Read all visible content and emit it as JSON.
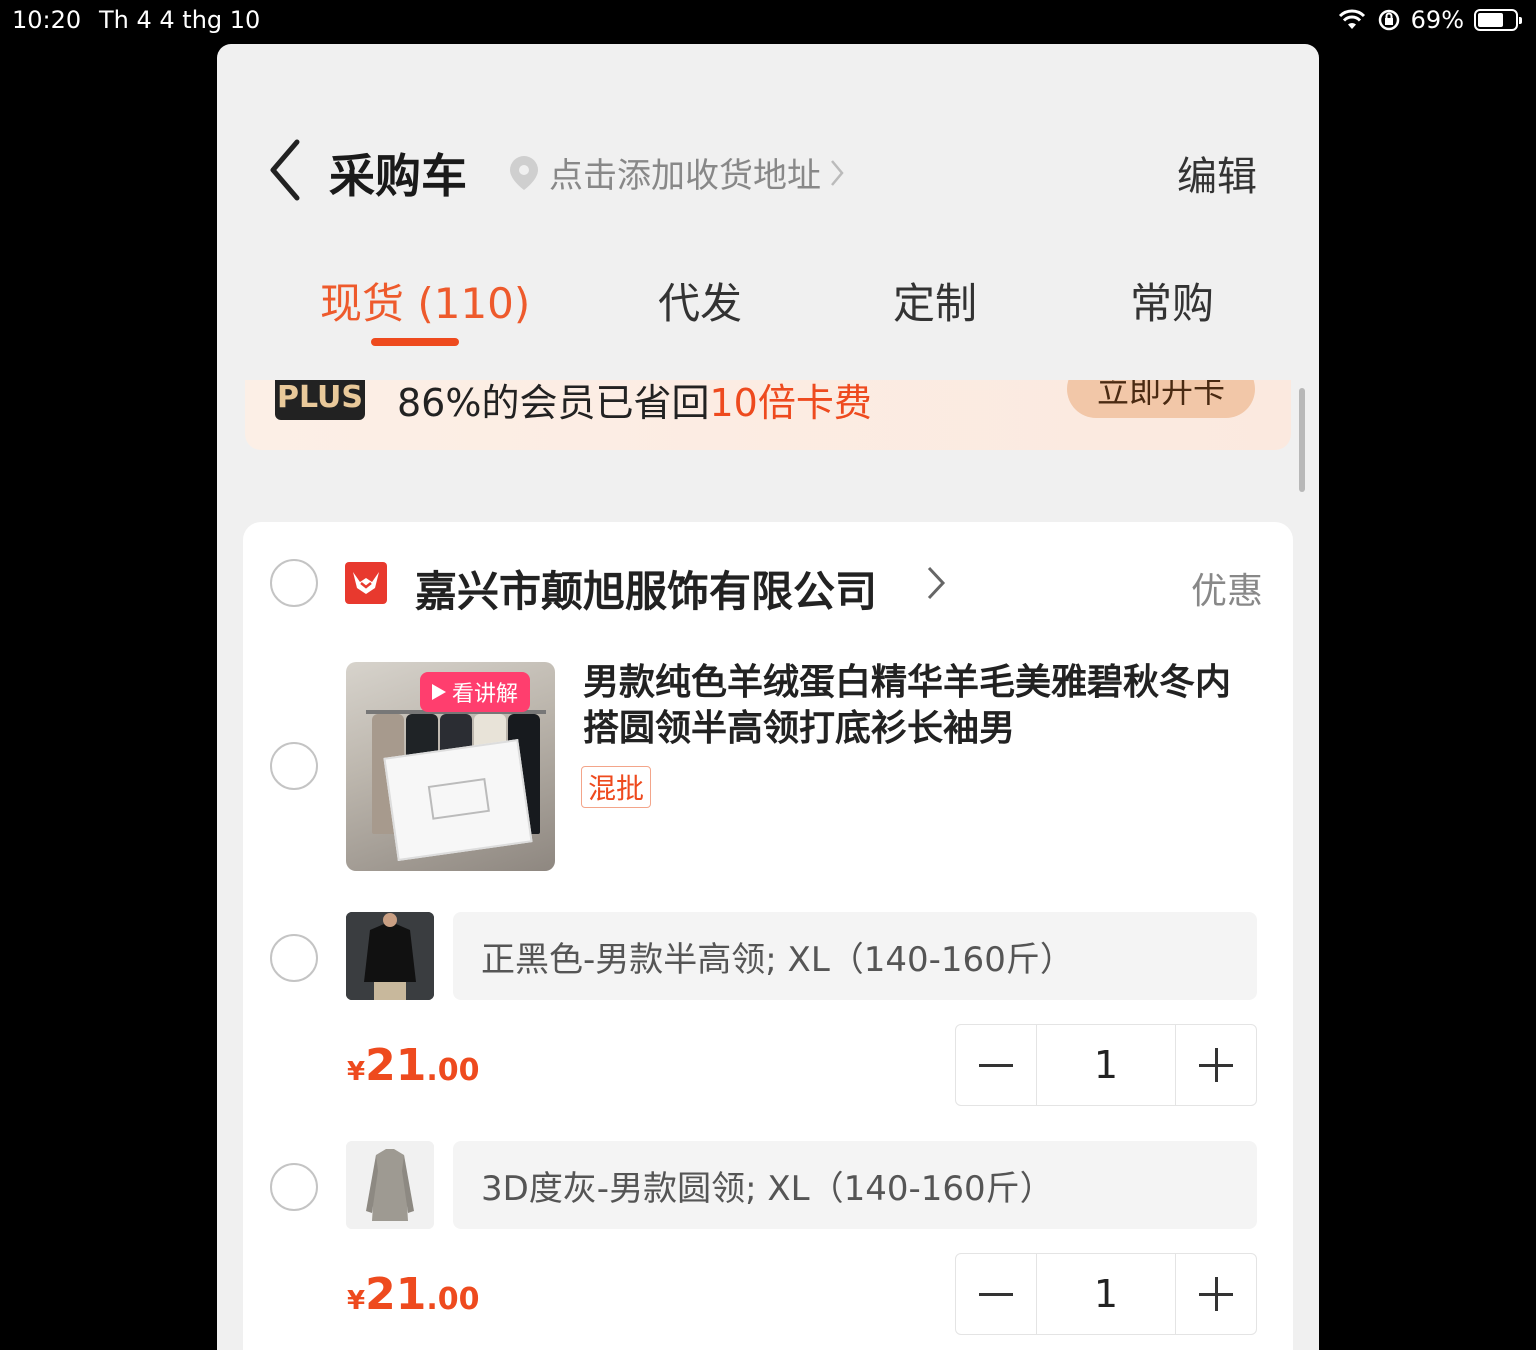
{
  "status_bar": {
    "time": "10:20",
    "date": "Th 4 4 thg 10",
    "battery_percent": "69%",
    "battery_level": 0.69
  },
  "header": {
    "title": "采购车",
    "address_placeholder": "点击添加收货地址",
    "edit_label": "编辑"
  },
  "tabs": [
    {
      "label": "现货 (110)",
      "active": true
    },
    {
      "label": "代发",
      "active": false
    },
    {
      "label": "定制",
      "active": false
    },
    {
      "label": "常购",
      "active": false
    }
  ],
  "plus_banner": {
    "badge": "PLUS",
    "text_prefix": "86%的会员已省回",
    "text_highlight": "10倍卡费",
    "cta": "立即开卡"
  },
  "shop": {
    "name": "嘉兴市颠旭服饰有限公司",
    "coupon_label": "优惠",
    "product": {
      "title": "男款纯色羊绒蛋白精华羊毛美雅碧秋冬内搭圆领半高领打底衫长袖男",
      "video_badge": "看讲解",
      "tag": "混批",
      "skus": [
        {
          "spec": "正黑色-男款半高领; XL（140-160斤）",
          "price_symbol": "¥",
          "price_int": "21",
          "price_dec": ".00",
          "quantity": "1"
        },
        {
          "spec": "3D度灰-男款圆领; XL（140-160斤）",
          "price_symbol": "¥",
          "price_int": "21",
          "price_dec": ".00",
          "quantity": "1"
        }
      ]
    }
  },
  "colors": {
    "accent": "#ee4a1e",
    "tab_active": "#ee5a2c",
    "shop_logo": "#e8392e",
    "video_badge": "#ff3e6e"
  }
}
